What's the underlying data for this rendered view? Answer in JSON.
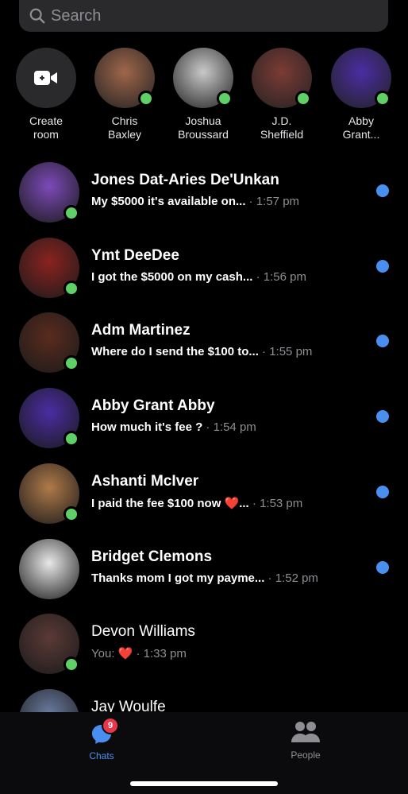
{
  "search": {
    "placeholder": "Search"
  },
  "stories": [
    {
      "name": "Create\nroom",
      "type": "create"
    },
    {
      "name": "Chris\nBaxley",
      "color": "#a0664b"
    },
    {
      "name": "Joshua\nBroussard",
      "color": "#c9c9c9"
    },
    {
      "name": "J.D.\nSheffield",
      "color": "#7d3b35"
    },
    {
      "name": "Abby\nGrant...",
      "color": "#4a2da3"
    }
  ],
  "chats": [
    {
      "name": "Jones Dat-Aries De'Unkan",
      "message": "My $5000 it's available on...",
      "time": "· 1:57 pm",
      "unread": true,
      "online": true,
      "color": "#7c4ab8"
    },
    {
      "name": "Ymt DeeDee",
      "message": "I got the $5000 on my cash...",
      "time": "· 1:56 pm",
      "unread": true,
      "online": true,
      "color": "#8a2320"
    },
    {
      "name": "Adm Martinez",
      "message": "Where do I send the $100 to...",
      "time": "· 1:55 pm",
      "unread": true,
      "online": true,
      "color": "#5a2b1e"
    },
    {
      "name": "Abby Grant Abby",
      "message": "How much it's fee ?",
      "time": "· 1:54 pm",
      "unread": true,
      "online": true,
      "color": "#4a2da3"
    },
    {
      "name": "Ashanti McIver",
      "message": "I paid the fee  $100 now ❤️...",
      "time": "· 1:53 pm",
      "unread": true,
      "online": true,
      "color": "#b07a4a"
    },
    {
      "name": "Bridget Clemons",
      "message": "Thanks mom I got my payme...",
      "time": "· 1:52 pm",
      "unread": true,
      "online": false,
      "color": "#e8e8e8"
    },
    {
      "name": "Devon Williams",
      "message": "You: ❤️",
      "time": "· 1:33 pm",
      "unread": false,
      "online": true,
      "color": "#5b3a36"
    },
    {
      "name": "Jay Woulfe",
      "message": "",
      "time": "",
      "unread": false,
      "online": false,
      "color": "#6a7ba0"
    }
  ],
  "tabs": {
    "chats": "Chats",
    "chats_badge": "9",
    "people": "People"
  },
  "colors": {
    "accent": "#4a8ff0",
    "online": "#5fd068"
  }
}
